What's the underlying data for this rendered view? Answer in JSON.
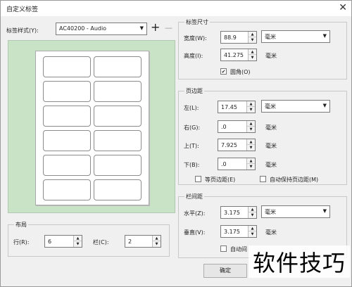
{
  "window": {
    "title": "自定义标签",
    "close_label": "✕"
  },
  "label_style": {
    "label": "标签样式(Y):",
    "value": "AC40200 - Audio",
    "add_label": "+",
    "remove_label": "—"
  },
  "preview": {
    "rows": 6,
    "cols": 2
  },
  "layout": {
    "title": "布局",
    "rows_label": "行(R):",
    "rows_value": "6",
    "cols_label": "栏(C):",
    "cols_value": "2"
  },
  "label_size": {
    "title": "标签尺寸",
    "width_label": "宽度(W):",
    "width_value": "88.9",
    "width_unit": "毫米",
    "height_label": "高度(I):",
    "height_value": "41.275",
    "height_unit": "毫米",
    "rounded_label": "圆角(O)",
    "rounded_checked": true
  },
  "margins": {
    "title": "页边距",
    "left_label": "左(L):",
    "left_value": "17.45",
    "left_unit": "毫米",
    "right_label": "右(G):",
    "right_value": ".0",
    "right_unit": "毫米",
    "top_label": "上(T):",
    "top_value": "7.925",
    "top_unit": "毫米",
    "bottom_label": "下(B):",
    "bottom_value": ".0",
    "bottom_unit": "毫米",
    "equal_label": "等页边距(E)",
    "auto_label": "自动保持页边距(M)"
  },
  "gutter": {
    "title": "栏间距",
    "horizontal_label": "水平(Z):",
    "horizontal_value": "3.175",
    "horizontal_unit": "毫米",
    "vertical_label": "垂直(V):",
    "vertical_value": "3.175",
    "vertical_unit": "毫米",
    "auto_label": "自动间"
  },
  "buttons": {
    "ok": "确定"
  },
  "watermark": "软件技巧"
}
